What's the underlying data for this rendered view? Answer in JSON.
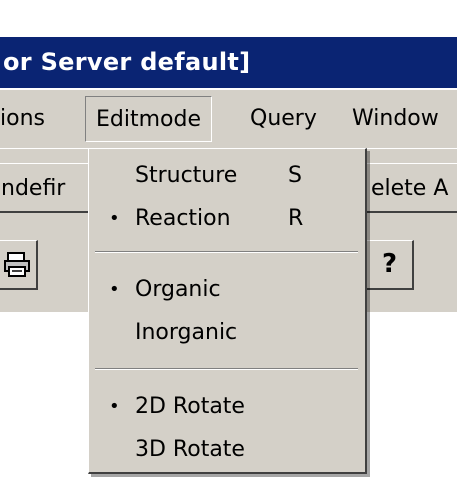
{
  "titlebar": {
    "text": "or Server default]"
  },
  "menubar": {
    "items": [
      {
        "label": "ions"
      },
      {
        "label": "Editmode"
      },
      {
        "label": "Query"
      },
      {
        "label": "Window"
      }
    ]
  },
  "toolbar": {
    "left_button_label": "ndefir",
    "right_button_label": "elete A"
  },
  "toolbar_icons": {
    "help_label": "?"
  },
  "editmode_menu": {
    "items": [
      {
        "label": "Structure",
        "shortcut": "S",
        "checked": false,
        "check_mark": ""
      },
      {
        "label": "Reaction",
        "shortcut": "R",
        "checked": true,
        "check_mark": "•"
      },
      {
        "label": "Organic",
        "shortcut": "",
        "checked": true,
        "check_mark": "•"
      },
      {
        "label": "Inorganic",
        "shortcut": "",
        "checked": false,
        "check_mark": ""
      },
      {
        "label": "2D Rotate",
        "shortcut": "",
        "checked": true,
        "check_mark": "•"
      },
      {
        "label": "3D Rotate",
        "shortcut": "",
        "checked": false,
        "check_mark": ""
      }
    ]
  },
  "colors": {
    "titlebar_bg": "#0a2473",
    "face": "#d4d0c8"
  }
}
